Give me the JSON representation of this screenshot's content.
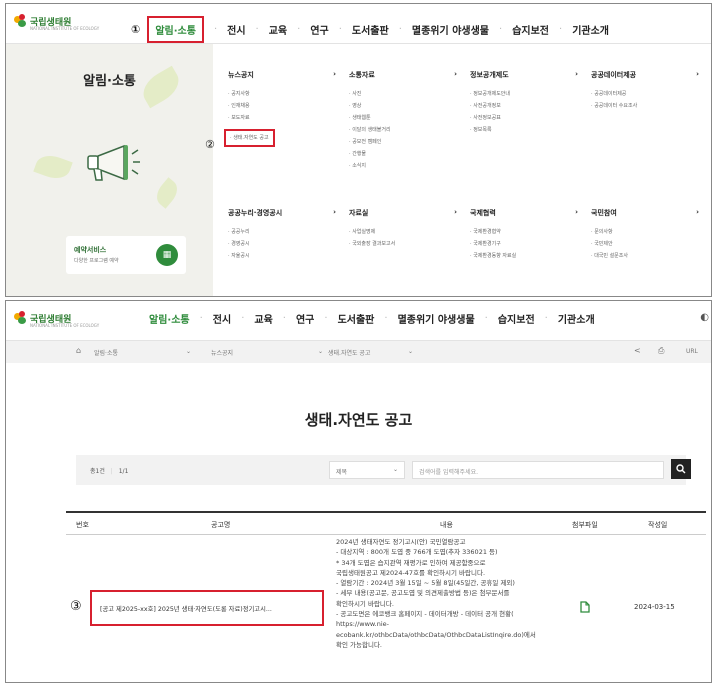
{
  "logo": {
    "name": "국립생태원",
    "sub": "NATIONAL INSTITUTE OF ECOLOGY"
  },
  "menu": [
    "알림·소통",
    "전시",
    "교육",
    "연구",
    "도서출판",
    "멸종위기 야생생물",
    "습지보전",
    "기관소개"
  ],
  "markers": {
    "step1": "①",
    "step2": "②",
    "step3": "③"
  },
  "mega": {
    "title": "알림·소통",
    "reserve": {
      "title": "예약서비스",
      "sub": "다양한 프로그램 예약"
    },
    "columns": [
      {
        "head": "뉴스공지",
        "items": [
          "공지사항",
          "인재채용",
          "보도자료",
          "생태.자연도 공고"
        ]
      },
      {
        "head": "소통자료",
        "items": [
          "사진",
          "영상",
          "생태웹툰",
          "이달의 생태볼거리",
          "공모전 캠페인",
          "간행물",
          "소식지"
        ]
      },
      {
        "head": "정보공개제도",
        "items": [
          "정보공개제도안내",
          "사전공개정보",
          "사전정보공표",
          "정보목록"
        ]
      },
      {
        "head": "공공데이터제공",
        "items": [
          "공공데이터제공",
          "공공데이터 수요조사"
        ]
      },
      {
        "head": "공공누리·경영공시",
        "items": [
          "공공누리",
          "경영공시",
          "자율공시"
        ]
      },
      {
        "head": "자료실",
        "items": [
          "사업실명제",
          "국외출장 결과보고서"
        ]
      },
      {
        "head": "국제협력",
        "items": [
          "국제환경협약",
          "국제환경기구",
          "국제환경동향 자료실"
        ]
      },
      {
        "head": "국민참여",
        "items": [
          "문의사항",
          "국민제안",
          "대국민 설문조사"
        ]
      }
    ]
  },
  "breadcrumb": {
    "home": "⌂",
    "c1": "알림·소통",
    "c2": "뉴스공지",
    "c3": "생태.자연도 공고",
    "share": "<",
    "print": "⎙",
    "url": "URL"
  },
  "page_title": "생태.자연도 공고",
  "search": {
    "count_label": "총1건",
    "page": "1/1",
    "field": "제목",
    "placeholder": "검색어를 입력해주세요.",
    "icon": "search-icon"
  },
  "table": {
    "headers": [
      "번호",
      "공고명",
      "내용",
      "첨부파일",
      "작성일"
    ],
    "row": {
      "title": "[공고 제2025-xx호] 2025년 생태·자연도(도롱 자료)정기고시...",
      "content": [
        "2024년 생태자연도 정기고시(안) 국민열람공고",
        "- 대상지역 : 800개 도엽 중 766개 도엽(추자 336021 등)",
        "* 34개 도엽은 습지관역 재평가로 인하여 제공함중으로",
        "국립생태원공고 제2024-47호를 확인하시기 바랍니다.",
        "- 열람기간 : 2024년 3월 15일 ~ 5월 8일(45일간, 공휴일 제외)",
        "- 세부 내용(공고문, 공고도엽 및 의견제출방법 등)은 첨부문서를",
        "확인하시기 바랍니다.",
        "- 공고도면은 에코뱅크 홈페이지 - 데이터개방 - 데이터 공개 현황(",
        "https://www.nie-",
        "ecobank.kr/othbcData/othbcData/OthbcDataListInqire.do)에서",
        "확인 가능합니다."
      ],
      "date": "2024-03-15"
    }
  }
}
